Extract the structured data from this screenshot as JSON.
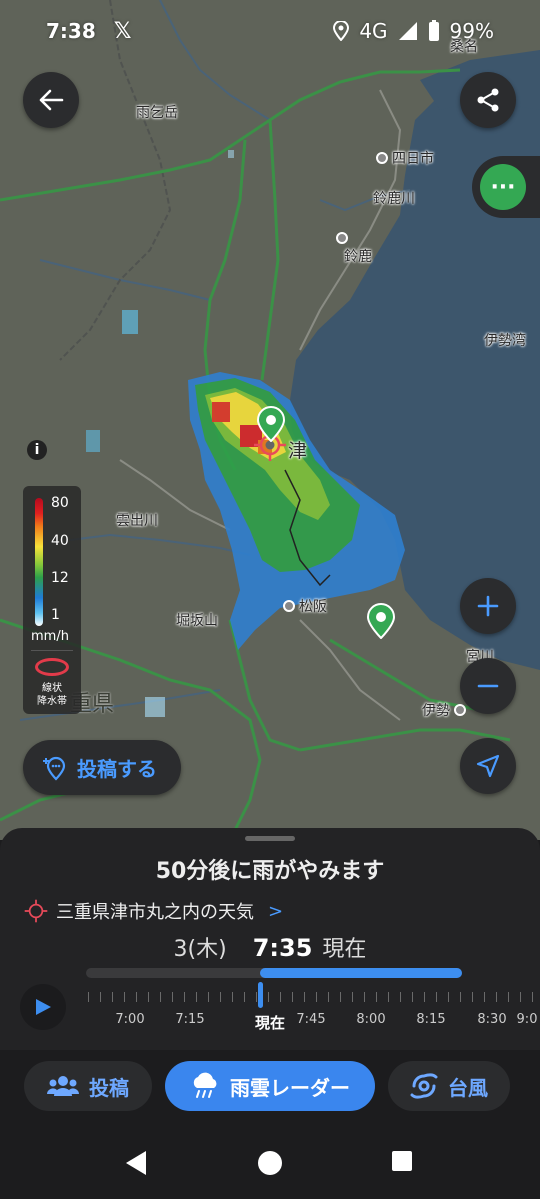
{
  "status_bar": {
    "time": "7:38",
    "x_app": "𝕏",
    "network": "4G",
    "battery": "99%"
  },
  "map": {
    "labels": [
      {
        "id": "amagodake",
        "text": "雨乞岳"
      },
      {
        "id": "kuwana",
        "text": "桑名"
      },
      {
        "id": "yokkaichi",
        "text": "四日市"
      },
      {
        "id": "suzukagawa",
        "text": "鈴鹿川"
      },
      {
        "id": "suzuka",
        "text": "鈴鹿"
      },
      {
        "id": "isewan",
        "text": "伊勢湾"
      },
      {
        "id": "tsu",
        "text": "津"
      },
      {
        "id": "kumozugawa",
        "text": "雲出川"
      },
      {
        "id": "matsusaka",
        "text": "松阪"
      },
      {
        "id": "horisakayama",
        "text": "堀坂山"
      },
      {
        "id": "mie",
        "text": "重県"
      },
      {
        "id": "miyagawa",
        "text": "宮川"
      },
      {
        "id": "ise",
        "text": "伊勢"
      }
    ]
  },
  "legend": {
    "values": [
      "80",
      "40",
      "12",
      "1"
    ],
    "unit": "mm/h",
    "band_label_line1": "線状",
    "band_label_line2": "降水帯"
  },
  "post_button": {
    "label": "投稿する"
  },
  "panel": {
    "headline": "50分後に雨がやみます",
    "place": "三重県津市丸之内の天気",
    "date": "3(木)",
    "clock": "7:35",
    "now_word": "現在",
    "timeline_labels": [
      "7:00",
      "7:15",
      "現在",
      "7:45",
      "8:00",
      "8:15",
      "8:30",
      "9:0"
    ],
    "progress": {
      "current_fraction": 0.463,
      "forecast_end_fraction": 1.0
    }
  },
  "tabs": [
    {
      "label": "投稿",
      "icon": "people-icon",
      "active": false
    },
    {
      "label": "雨雲レーダー",
      "icon": "rain-cloud-icon",
      "active": true
    },
    {
      "label": "台風",
      "icon": "typhoon-icon",
      "active": false
    }
  ],
  "colors": {
    "accent": "#3d8ef0",
    "green_pin": "#34a853",
    "panel_bg": "#232325"
  }
}
